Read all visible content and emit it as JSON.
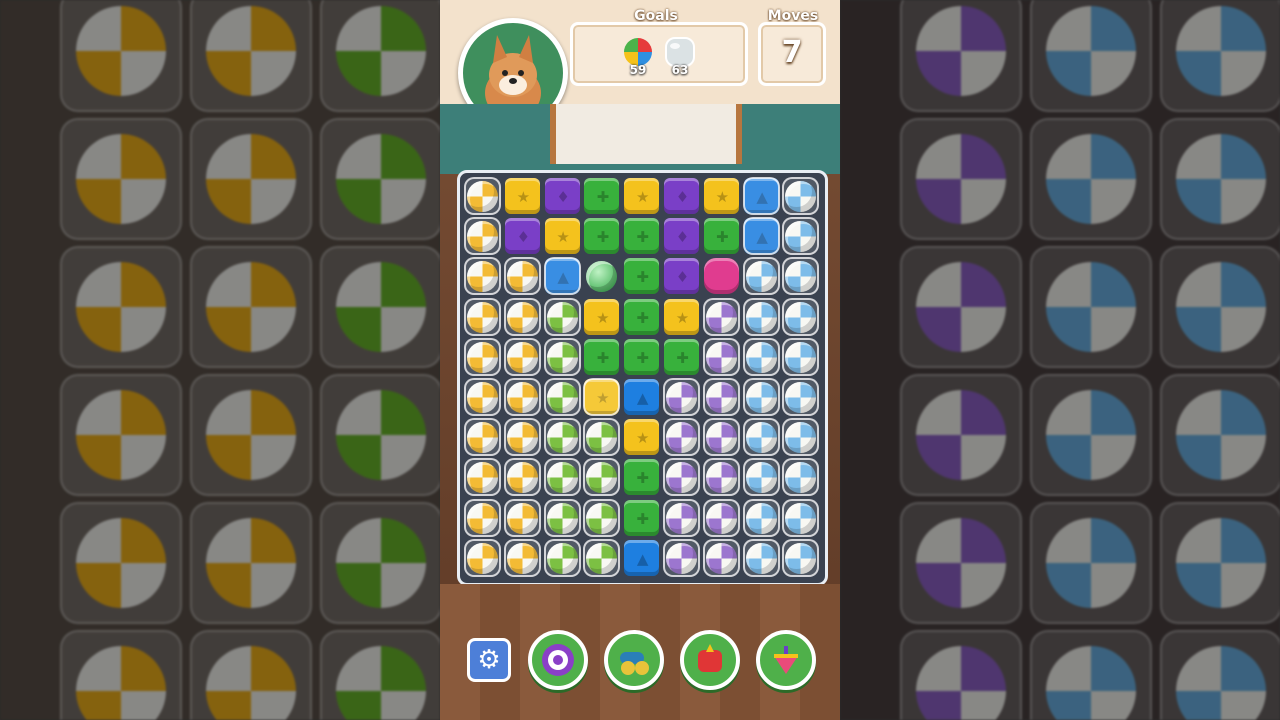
{
  "hud": {
    "goals_label": "Goals",
    "moves_label": "Moves",
    "moves_value": "7",
    "goals": [
      {
        "icon": "beach-ball-goal-icon",
        "count": "59"
      },
      {
        "icon": "bubble-goal-icon",
        "count": "63"
      }
    ]
  },
  "colors": {
    "yellow": "#f4c21d",
    "purple": "#7a3fc7",
    "green": "#38b13c",
    "blue": "#1e7fe0",
    "ball_yellow": "#f2b21a",
    "ball_green": "#6ab82a",
    "ball_purple": "#8f63c9",
    "ball_blue": "#6bb3e6"
  },
  "board": {
    "rows": [
      [
        "by",
        "Y",
        "P",
        "G",
        "Y",
        "P",
        "Y",
        "B~",
        "bb"
      ],
      [
        "by",
        "P",
        "Y",
        "G",
        "G",
        "P",
        "G",
        "B~",
        "bb"
      ],
      [
        "by",
        "by",
        "B~",
        "Gs",
        "G",
        "P",
        "Pk",
        "bb",
        "bb"
      ],
      [
        "by",
        "by",
        "bg",
        "Y",
        "G",
        "Y",
        "bp",
        "bb",
        "bb"
      ],
      [
        "by",
        "by",
        "bg",
        "G",
        "G",
        "G",
        "bp",
        "bb",
        "bb"
      ],
      [
        "by",
        "by",
        "bg",
        "Y~",
        "B",
        "bp",
        "bp",
        "bb",
        "bb"
      ],
      [
        "by",
        "by",
        "bg",
        "bg",
        "Y",
        "bp",
        "bp",
        "bb",
        "bb"
      ],
      [
        "by",
        "by",
        "bg",
        "bg",
        "G",
        "bp",
        "bp",
        "bb",
        "bb"
      ],
      [
        "by",
        "by",
        "bg",
        "bg",
        "G",
        "bp",
        "bp",
        "bb",
        "bb"
      ],
      [
        "by",
        "by",
        "bg",
        "bg",
        "B",
        "bp",
        "bp",
        "bb",
        "bb"
      ]
    ]
  },
  "boosters": [
    {
      "name": "settings-gear-icon"
    },
    {
      "name": "target-booster-icon"
    },
    {
      "name": "cannon-booster-icon"
    },
    {
      "name": "boxing-glove-booster-icon"
    },
    {
      "name": "spinning-top-booster-icon"
    }
  ]
}
